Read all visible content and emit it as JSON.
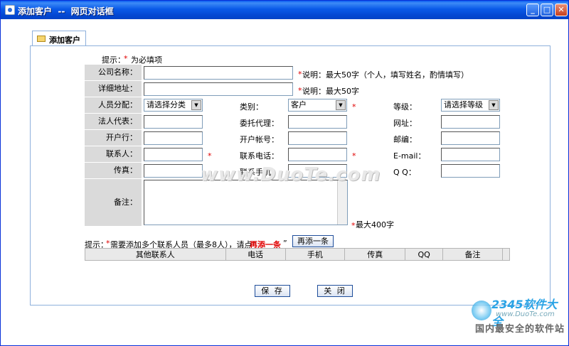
{
  "window": {
    "title": "添加客户  --  网页对话框"
  },
  "tab": {
    "label": "添加客户"
  },
  "form": {
    "tip_prefix": "提示：",
    "tip_required": "为必填项",
    "company_name_label": "公司名称：",
    "company_name_note": "说明：最大50字（个人，填写姓名，酌情填写）",
    "address_label": "详细地址：",
    "address_note": "说明：最大50字",
    "assign_label": "人员分配：",
    "assign_selected": "请选择分类",
    "category_label": "类别：",
    "category_selected": "客户",
    "grade_label": "等级：",
    "grade_selected": "请选择等级",
    "legal_rep_label": "法人代表：",
    "agent_label": "委托代理：",
    "website_label": "网址：",
    "bank_label": "开户行：",
    "account_label": "开户帐号：",
    "postcode_label": "邮编：",
    "contact_label": "联系人：",
    "phone_label": "联系电话：",
    "email_label": "E-mail：",
    "fax_label": "传真：",
    "mobile_label": "联系手机：",
    "qq_label": "Q Q：",
    "remark_label": "备注：",
    "remark_note": "最大400字",
    "asterisk": "*"
  },
  "contacts": {
    "tip_prefix": "提示：",
    "tip_text": "需要添加多个联系人员（最多8人），请点“",
    "tip_link": "再添一条",
    "tip_suffix": "”",
    "add_button": "再添一条",
    "columns": [
      "其他联系人",
      "电话",
      "手机",
      "传真",
      "QQ",
      "备注"
    ]
  },
  "actions": {
    "save": "保 存",
    "close": "关 闭"
  },
  "watermark": {
    "text": "www.DuoTe.com",
    "logo_main": "2345软件大全",
    "logo_url": "www.DuoTe.com",
    "slogan": "国内最安全的软件站"
  }
}
